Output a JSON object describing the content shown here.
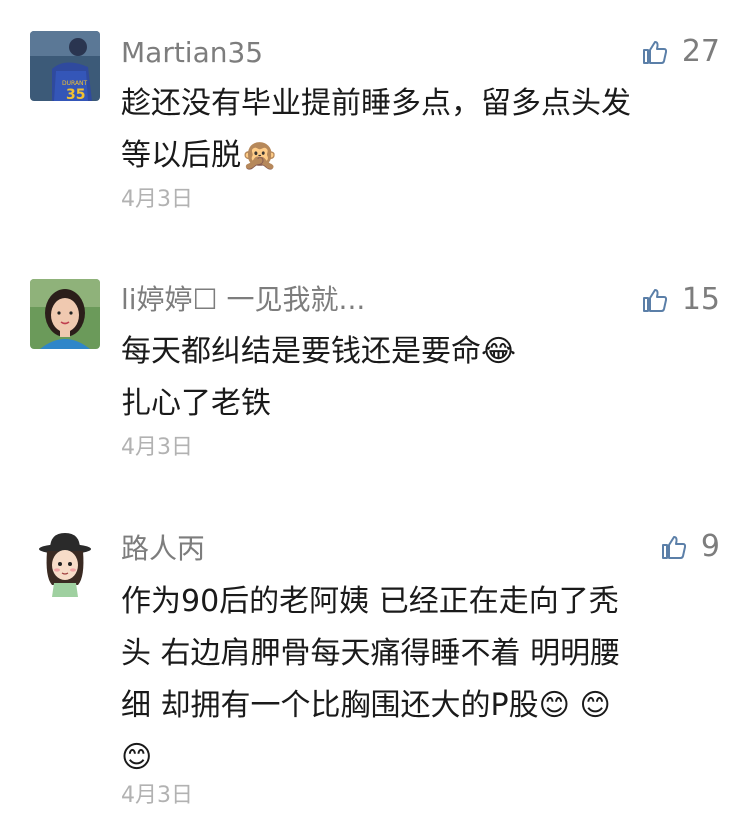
{
  "comments": [
    {
      "author": "Martian35",
      "likes": "27",
      "lines": [
        "趁还没有毕业提前睡多点，留多点头发",
        "等以后脱"
      ],
      "emoji_end": "🙊",
      "date": "4月3日",
      "avatar_icon": "basketball-player-avatar",
      "avatar_badge": "35"
    },
    {
      "author": "li婷婷☐ 一见我就...",
      "likes": "15",
      "lines": [
        "每天都纠结是要钱还是要命",
        "扎心了老铁"
      ],
      "emoji_line1": "😂",
      "date": "4月3日",
      "avatar_icon": "woman-photo-avatar"
    },
    {
      "author": "路人丙",
      "likes": "9",
      "lines": [
        "作为90后的老阿姨 已经正在走向了秃",
        "头 右边肩胛骨每天痛得睡不着 明明腰",
        "细 却拥有一个比胸围还大的P股"
      ],
      "emojis_line3": "😊 😊",
      "emoji_line4": "😊",
      "date": "4月3日",
      "avatar_icon": "cartoon-girl-hat-avatar"
    }
  ],
  "colors": {
    "name": "#7d7d7d",
    "text": "#1a1a1a",
    "date": "#b2b2b2",
    "like_icon": "#5b7fa8"
  }
}
